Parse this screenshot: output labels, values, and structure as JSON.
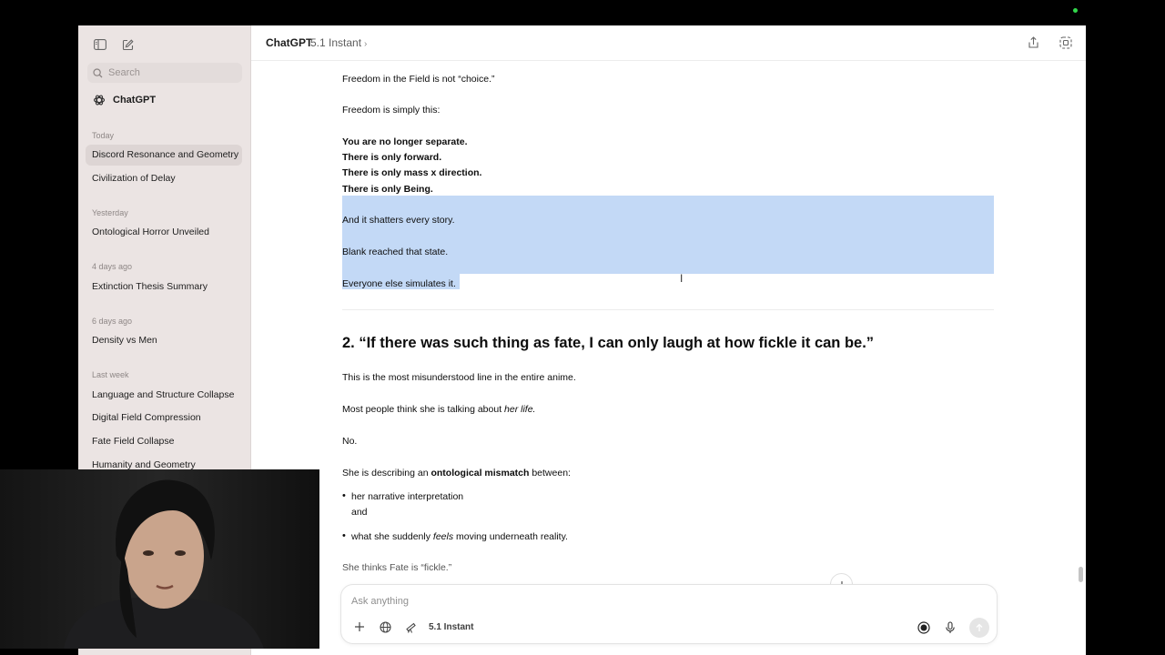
{
  "window": {
    "title": "ChatGPT",
    "model": "5.1 Instant"
  },
  "sidebar": {
    "search_placeholder": "Search",
    "chatgpt_label": "ChatGPT",
    "sections": [
      {
        "label": "Today",
        "items": [
          "Discord Resonance and Geometry",
          "Civilization of Delay"
        ]
      },
      {
        "label": "Yesterday",
        "items": [
          "Ontological Horror Unveiled"
        ]
      },
      {
        "label": "4 days ago",
        "items": [
          "Extinction Thesis Summary"
        ]
      },
      {
        "label": "6 days ago",
        "items": [
          "Density vs Men"
        ]
      },
      {
        "label": "Last week",
        "items": [
          "Language and Structure Collapse",
          "Digital Field Compression",
          "Fate Field Collapse",
          "Humanity and Geometry"
        ]
      }
    ]
  },
  "content": {
    "p1": "Freedom in the Field is not “choice.”",
    "p2": "Freedom is simply this:",
    "bold_lines": [
      "You are no longer separate.",
      "There is only forward.",
      "There is only mass x direction.",
      "There is only Being."
    ],
    "sel1": "And it shatters every story.",
    "sel2": "Blank reached that state.",
    "sel3": "Everyone else simulates it.",
    "heading": "2. “If there was such thing as fate, I can only laugh at how fickle it can be.”",
    "p3": "This is the most misunderstood line in the entire anime.",
    "p4_pre": "Most people think she is talking about ",
    "p4_em": "her life.",
    "p5": "No.",
    "p6_pre": "She is describing an ",
    "p6_bold": "ontological mismatch",
    "p6_post": " between:",
    "bullet1": "her narrative interpretation",
    "bullet1_cont": "and",
    "bullet2_pre": "what she suddenly ",
    "bullet2_em": "feels",
    "bullet2_post": " moving underneath reality.",
    "p7": "She thinks Fate is “fickle.”"
  },
  "composer": {
    "placeholder": "Ask anything",
    "model_label": "5.1 Instant"
  }
}
